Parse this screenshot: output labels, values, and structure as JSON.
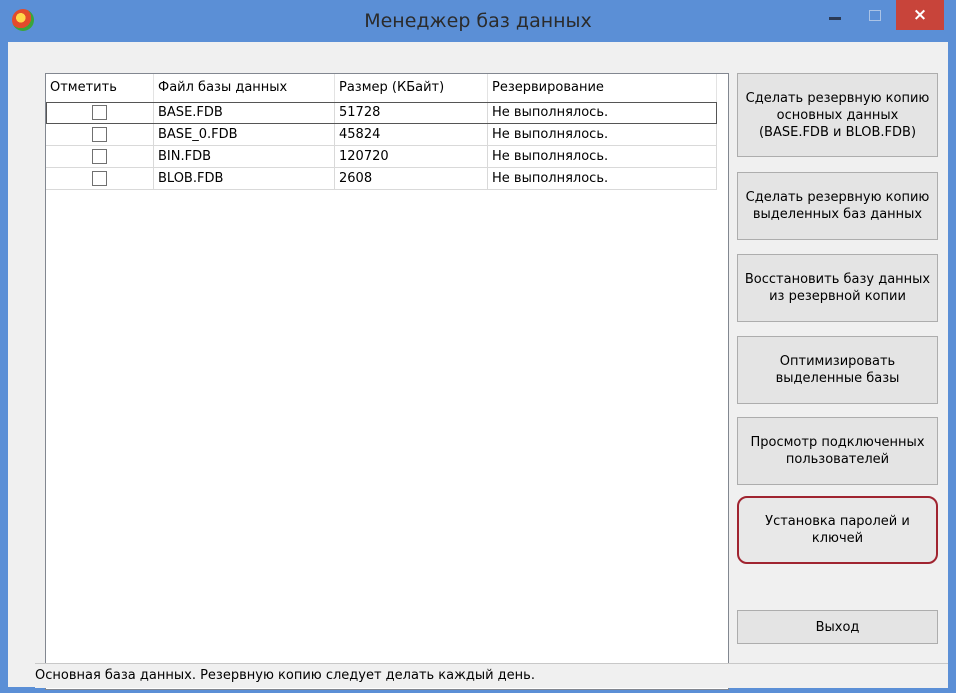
{
  "window": {
    "title": "Менеджер баз данных",
    "close_glyph": "×"
  },
  "columns": [
    "Отметить",
    "Файл базы данных",
    "Размер (КБайт)",
    "Резервирование"
  ],
  "rows": [
    {
      "checked": false,
      "file": "BASE.FDB",
      "size": "51728",
      "backup": "Не выполнялось."
    },
    {
      "checked": false,
      "file": "BASE_0.FDB",
      "size": "45824",
      "backup": "Не выполнялось."
    },
    {
      "checked": false,
      "file": "BIN.FDB",
      "size": "120720",
      "backup": "Не выполнялось."
    },
    {
      "checked": false,
      "file": "BLOB.FDB",
      "size": "2608",
      "backup": "Не выполнялось."
    }
  ],
  "buttons": {
    "backup_main": "Сделать резервную копию основных данных (BASE.FDB и BLOB.FDB)",
    "backup_selected": "Сделать резервную копию выделенных баз данных",
    "restore": "Восстановить базу данных из резервной копии",
    "optimize": "Оптимизировать выделенные базы",
    "view_users": "Просмотр подключенных пользователей",
    "set_passwords": "Установка паролей и ключей",
    "exit": "Выход"
  },
  "status": "Основная база данных. Резервную копию следует делать каждый день."
}
